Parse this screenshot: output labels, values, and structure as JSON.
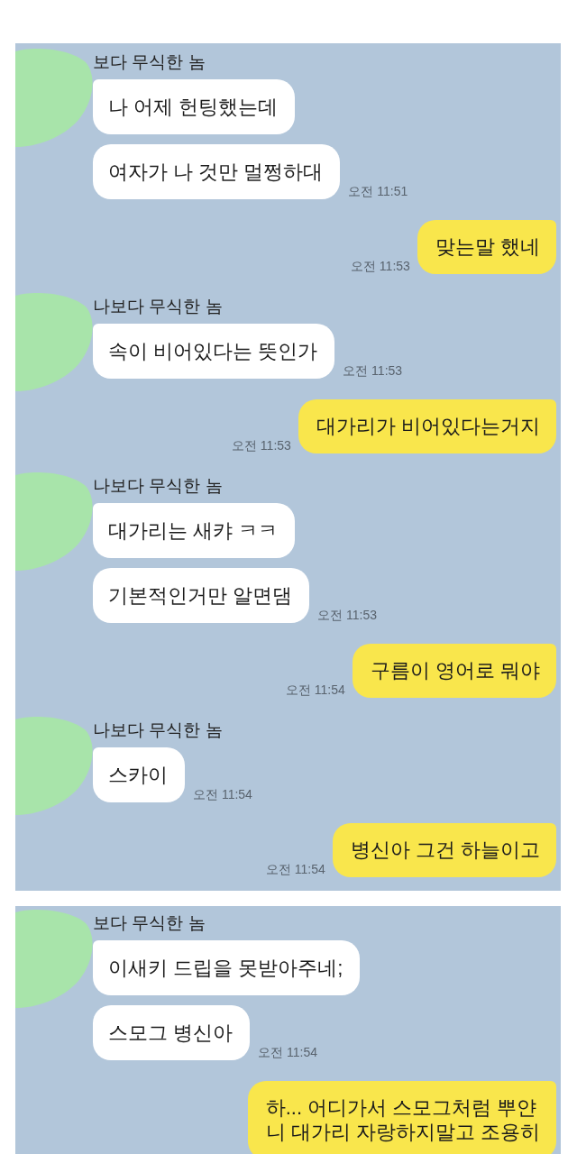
{
  "panels": [
    {
      "messages": [
        {
          "kind": "incoming",
          "sender": "보다 무식한 놈",
          "bubbles": [
            "나 어제 헌팅했는데",
            "여자가 나 것만 멀쩡하대"
          ],
          "time": "오전 11:51"
        },
        {
          "kind": "outgoing",
          "bubbles": [
            "맞는말 했네"
          ],
          "time": "오전 11:53"
        },
        {
          "kind": "incoming",
          "sender": "나보다 무식한 놈",
          "bubbles": [
            "속이 비어있다는 뜻인가"
          ],
          "time": "오전 11:53"
        },
        {
          "kind": "outgoing",
          "bubbles": [
            "대가리가 비어있다는거지"
          ],
          "time": "오전 11:53"
        },
        {
          "kind": "incoming",
          "sender": "나보다 무식한 놈",
          "bubbles": [
            "대가리는 새캬 ㅋㅋ",
            "기본적인거만 알면댐"
          ],
          "time": "오전 11:53"
        },
        {
          "kind": "outgoing",
          "bubbles": [
            "구름이 영어로 뭐야"
          ],
          "time": "오전 11:54"
        },
        {
          "kind": "incoming",
          "sender": "나보다 무식한 놈",
          "bubbles": [
            "스카이"
          ],
          "time": "오전 11:54"
        },
        {
          "kind": "outgoing",
          "bubbles": [
            "병신아 그건 하늘이고"
          ],
          "time": "오전 11:54"
        }
      ]
    },
    {
      "messages": [
        {
          "kind": "incoming",
          "sender": "보다 무식한 놈",
          "bubbles": [
            "이새키 드립을 못받아주네;",
            "스모그 병신아"
          ],
          "time": "오전 11:54"
        },
        {
          "kind": "outgoing",
          "bubbles": [
            "하... 어디가서 스모그처럼 뿌얀\n니 대가리 자랑하지말고 조용히"
          ]
        }
      ]
    }
  ]
}
